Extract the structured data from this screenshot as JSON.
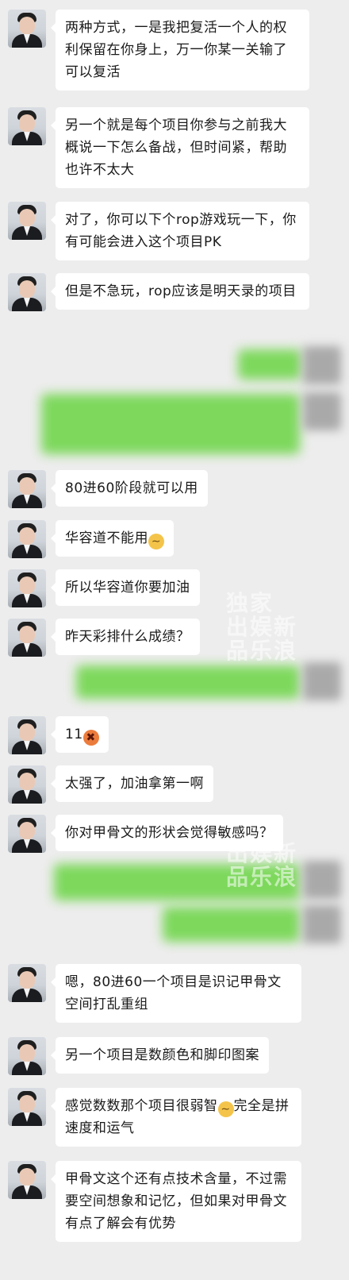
{
  "messages": [
    {
      "text": "两种方式，一是我把复活一个人的权利保留在你身上，万一你某一关输了可以复活"
    },
    {
      "text": "另一个就是每个项目你参与之前我大概说一下怎么备战，但时间紧，帮助也许不太大"
    },
    {
      "text": "对了，你可以下个rop游戏玩一下，你有可能会进入这个项目PK"
    },
    {
      "text": "但是不急玩，rop应该是明天录的项目"
    },
    {
      "text": "80进60阶段就可以用"
    },
    {
      "text": "华容道不能用",
      "emoji": "smug"
    },
    {
      "text": "所以华容道你要加油"
    },
    {
      "text": "昨天彩排什么成绩？"
    },
    {
      "text": "11",
      "emoji": "angry"
    },
    {
      "text": "太强了，加油拿第一啊"
    },
    {
      "text": "你对甲骨文的形状会觉得敏感吗？"
    },
    {
      "text": "嗯，80进60一个项目是识记甲骨文空间打乱重组"
    },
    {
      "text": "另一个项目是数颜色和脚印图案"
    },
    {
      "text": "感觉数数那个项目很弱智",
      "emoji": "smug",
      "text_after": "完全是拼速度和运气"
    },
    {
      "text": "甲骨文这个还有点技术含量，不过需要空间想象和记忆，但如果对甲骨文有点了解会有优势"
    }
  ],
  "watermark": {
    "line1": "独家",
    "line2": "出娱新",
    "line3": "品乐浪"
  },
  "colors": {
    "background": "#ededed",
    "incoming_bubble": "#ffffff",
    "outgoing_bubble_blurred": "#7dd85c"
  },
  "icons": {
    "smug": "smirk-emoji-icon",
    "angry": "angry-emoji-icon"
  }
}
